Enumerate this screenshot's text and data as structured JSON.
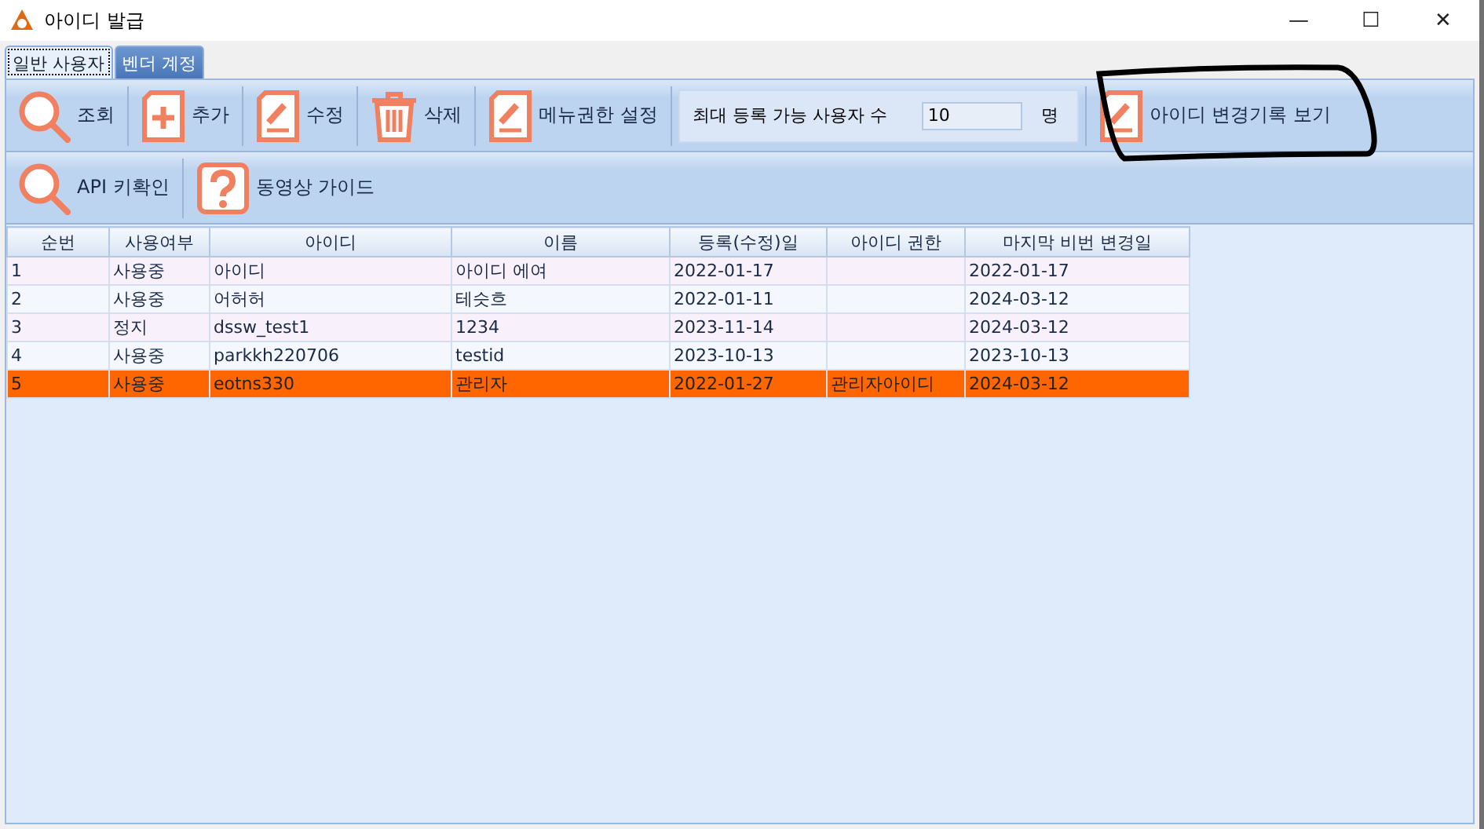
{
  "window": {
    "title": "아이디 발급",
    "controls": [
      "—",
      "☐",
      "✕"
    ]
  },
  "tabs": [
    {
      "label": "일반 사용자",
      "selected": true
    },
    {
      "label": "벤더 계정",
      "selected": false
    }
  ],
  "toolbar_rows": [
    [
      {
        "kind": "search",
        "label": "조회"
      },
      {
        "kind": "add",
        "label": "추가"
      },
      {
        "kind": "edit",
        "label": "수정"
      },
      {
        "kind": "delete",
        "label": "삭제"
      },
      {
        "kind": "edit",
        "label": "메뉴권한 설정"
      },
      {
        "kind": "setting",
        "label": "최대 등록 가능 사용자 수",
        "value": "10",
        "unit": "명"
      },
      {
        "kind": "edit",
        "label": "아이디 변경기록 보기"
      }
    ],
    [
      {
        "kind": "search",
        "label": "API 키확인"
      },
      {
        "kind": "help",
        "label": "동영상 가이드"
      }
    ]
  ],
  "table": {
    "columns": [
      "순번",
      "사용여부",
      "아이디",
      "이름",
      "등록(수정)일",
      "아이디 권한",
      "마지막 비번 변경일"
    ],
    "rows": [
      {
        "selected": false,
        "cells": [
          "1",
          "사용중",
          "아이디",
          "아이디 에여",
          "2022-01-17",
          "",
          "2022-01-17"
        ]
      },
      {
        "selected": false,
        "cells": [
          "2",
          "사용중",
          "어허허",
          "테슷흐",
          "2022-01-11",
          "",
          "2024-03-12"
        ]
      },
      {
        "selected": false,
        "cells": [
          "3",
          "정지",
          "dssw_test1",
          "1234",
          "2023-11-14",
          "",
          "2024-03-12"
        ]
      },
      {
        "selected": false,
        "cells": [
          "4",
          "사용중",
          "parkkh220706",
          "testid",
          "2023-10-13",
          "",
          "2023-10-13"
        ]
      },
      {
        "selected": true,
        "cells": [
          "5",
          "사용중",
          "eotns330",
          "관리자",
          "2022-01-27",
          "관리자아이디",
          "2024-03-12"
        ]
      }
    ]
  }
}
